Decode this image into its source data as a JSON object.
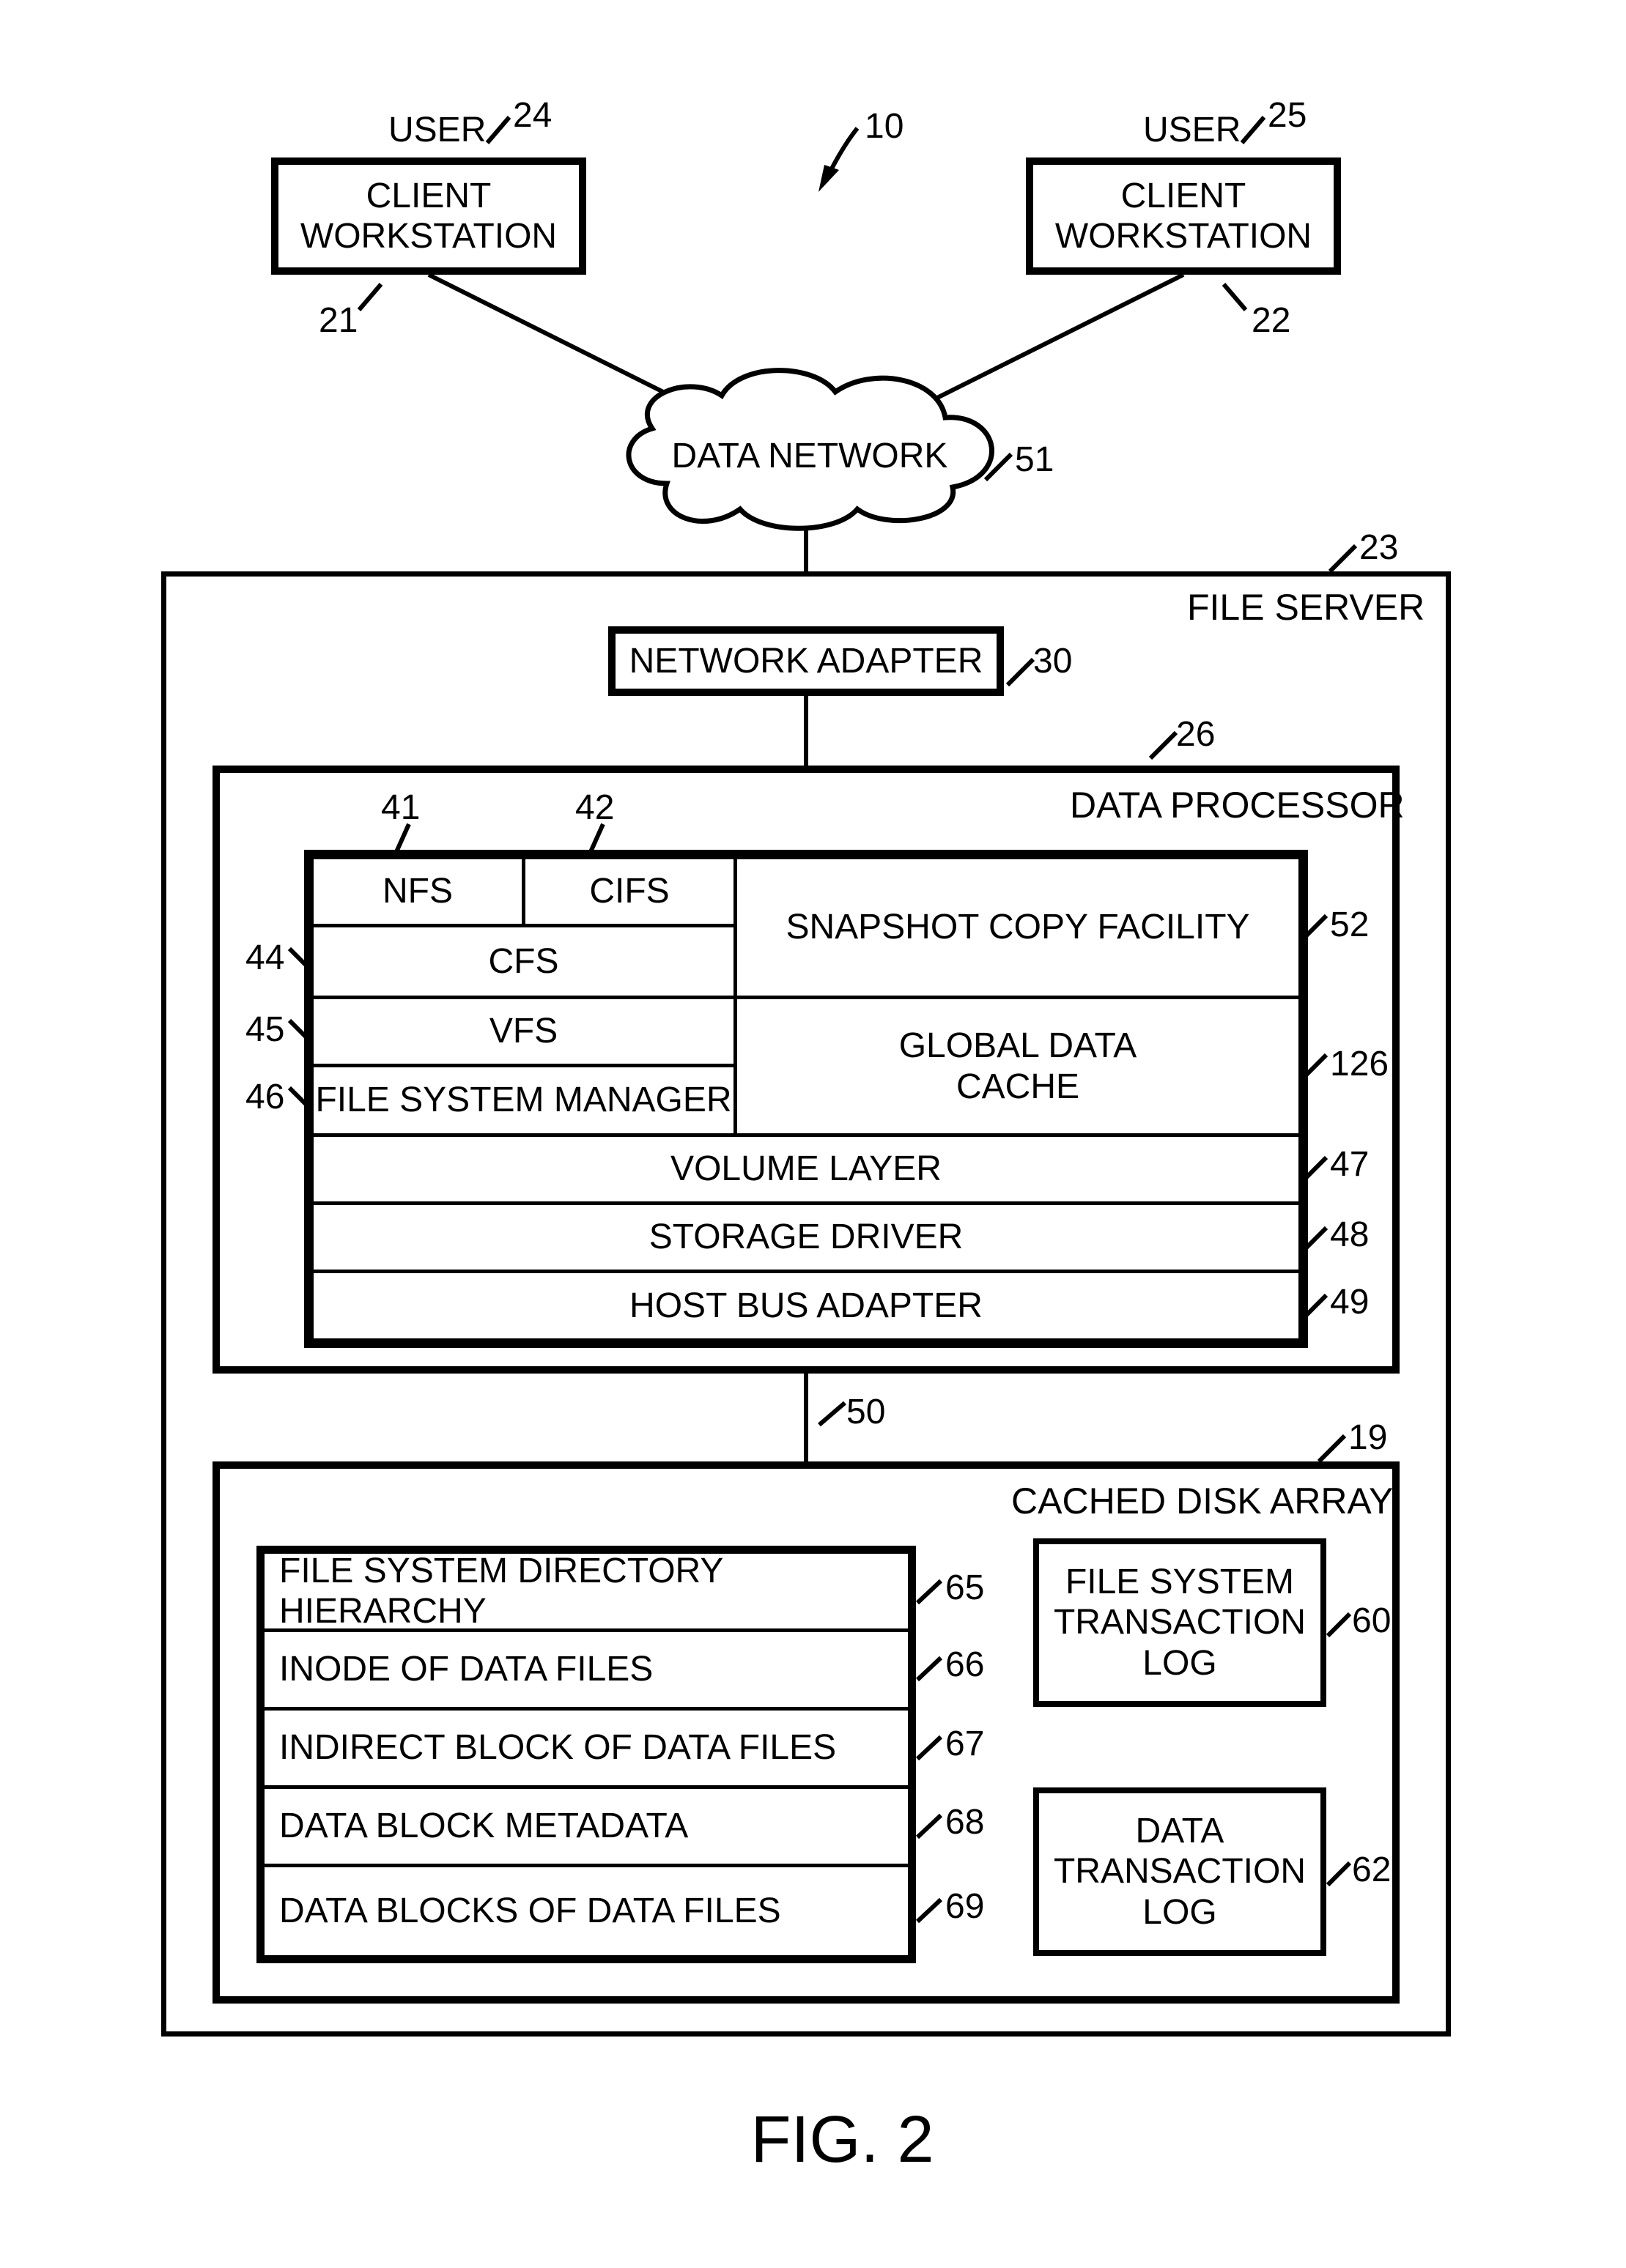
{
  "refs": {
    "r10": "10",
    "r19": "19",
    "r21": "21",
    "r22": "22",
    "r23": "23",
    "r24": "24",
    "r25": "25",
    "r26": "26",
    "r30": "30",
    "r41": "41",
    "r42": "42",
    "r44": "44",
    "r45": "45",
    "r46": "46",
    "r47": "47",
    "r48": "48",
    "r49": "49",
    "r50": "50",
    "r51": "51",
    "r52": "52",
    "r60": "60",
    "r62": "62",
    "r65": "65",
    "r66": "66",
    "r67": "67",
    "r68": "68",
    "r69": "69",
    "r126": "126"
  },
  "labels": {
    "user1": "USER",
    "user2": "USER",
    "client1": "CLIENT\nWORKSTATION",
    "client2": "CLIENT\nWORKSTATION",
    "data_network": "DATA NETWORK",
    "file_server": "FILE SERVER",
    "network_adapter": "NETWORK ADAPTER",
    "data_processor": "DATA PROCESSOR",
    "nfs": "NFS",
    "cifs": "CIFS",
    "cfs": "CFS",
    "vfs": "VFS",
    "fsm": "FILE SYSTEM MANAGER",
    "snapshot": "SNAPSHOT COPY FACILITY",
    "global_cache": "GLOBAL DATA\nCACHE",
    "volume_layer": "VOLUME LAYER",
    "storage_driver": "STORAGE DRIVER",
    "hba": "HOST BUS ADAPTER",
    "cached_disk_array": "CACHED DISK ARRAY",
    "fs_dir": "FILE SYSTEM DIRECTORY HIERARCHY",
    "inode": "INODE OF DATA FILES",
    "indirect": "INDIRECT BLOCK OF DATA FILES",
    "dbm": "DATA BLOCK METADATA",
    "dblocks": "DATA BLOCKS OF DATA FILES",
    "fs_tlog": "FILE SYSTEM\nTRANSACTION\nLOG",
    "data_tlog": "DATA\nTRANSACTION\nLOG"
  },
  "figure": "FIG. 2"
}
